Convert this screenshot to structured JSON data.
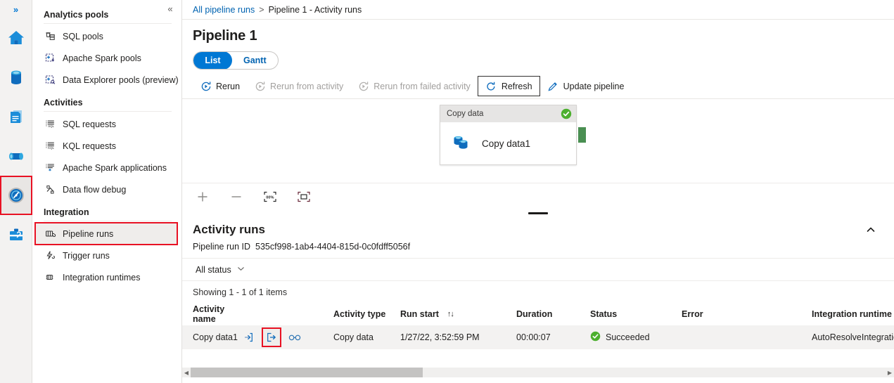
{
  "rail": {
    "expand_label": "»",
    "items": [
      {
        "name": "home",
        "title": "Home"
      },
      {
        "name": "data",
        "title": "Data"
      },
      {
        "name": "develop",
        "title": "Develop"
      },
      {
        "name": "integrate",
        "title": "Integrate"
      },
      {
        "name": "monitor",
        "title": "Monitor",
        "selected": true
      },
      {
        "name": "manage",
        "title": "Manage"
      }
    ]
  },
  "sidebar": {
    "collapse_label": "«",
    "groups": [
      {
        "title": "Analytics pools",
        "items": [
          {
            "label": "SQL pools",
            "icon": "sql-pools-icon"
          },
          {
            "label": "Apache Spark pools",
            "icon": "spark-pools-icon"
          },
          {
            "label": "Data Explorer pools (preview)",
            "icon": "data-explorer-pools-icon"
          }
        ]
      },
      {
        "title": "Activities",
        "items": [
          {
            "label": "SQL requests",
            "icon": "sql-requests-icon"
          },
          {
            "label": "KQL requests",
            "icon": "kql-requests-icon"
          },
          {
            "label": "Apache Spark applications",
            "icon": "spark-applications-icon"
          },
          {
            "label": "Data flow debug",
            "icon": "data-flow-debug-icon"
          }
        ]
      },
      {
        "title": "Integration",
        "items": [
          {
            "label": "Pipeline runs",
            "icon": "pipeline-runs-icon",
            "highlighted": true
          },
          {
            "label": "Trigger runs",
            "icon": "trigger-runs-icon"
          },
          {
            "label": "Integration runtimes",
            "icon": "integration-runtimes-icon"
          }
        ]
      }
    ]
  },
  "breadcrumb": {
    "root": "All pipeline runs",
    "separator": ">",
    "current": "Pipeline 1 - Activity runs"
  },
  "page": {
    "title": "Pipeline 1"
  },
  "view_toggle": {
    "list": "List",
    "gantt": "Gantt",
    "active": "List"
  },
  "toolbar": {
    "rerun": "Rerun",
    "rerun_from_activity": "Rerun from activity",
    "rerun_from_failed_activity": "Rerun from failed activity",
    "refresh": "Refresh",
    "update_pipeline": "Update pipeline"
  },
  "canvas": {
    "node": {
      "type_label": "Copy data",
      "name": "Copy data1",
      "status": "Succeeded",
      "status_color": "#4caf2e"
    },
    "connector_color": "#4a8f52",
    "zoom_controls": [
      {
        "name": "zoom-in-icon",
        "glyph": "+"
      },
      {
        "name": "zoom-out-icon",
        "glyph": "−"
      },
      {
        "name": "zoom-to-fit-icon",
        "glyph": "00%"
      },
      {
        "name": "fit-to-screen-icon",
        "glyph": "⬚"
      }
    ]
  },
  "activity_runs": {
    "title": "Activity runs",
    "collapse_icon": "chevron-up-icon",
    "run_id_label": "Pipeline run ID",
    "run_id_value": "535cf998-1ab4-4404-815d-0c0fdff5056f",
    "status_filter": "All status",
    "showing": "Showing 1 - 1 of 1 items",
    "columns": [
      "Activity name",
      "",
      "Activity type",
      "Run start",
      "Duration",
      "Status",
      "Error",
      "Integration runtime"
    ],
    "rows": [
      {
        "activity_name": "Copy data1",
        "activity_type": "Copy data",
        "run_start": "1/27/22, 3:52:59 PM",
        "duration": "00:00:07",
        "status": "Succeeded",
        "error": "",
        "integration_runtime": "AutoResolveIntegrationRuntime"
      }
    ]
  },
  "colors": {
    "accent": "#0078d4",
    "link": "#0063b1",
    "success": "#4caf2e",
    "highlight_outline": "#e81123"
  }
}
